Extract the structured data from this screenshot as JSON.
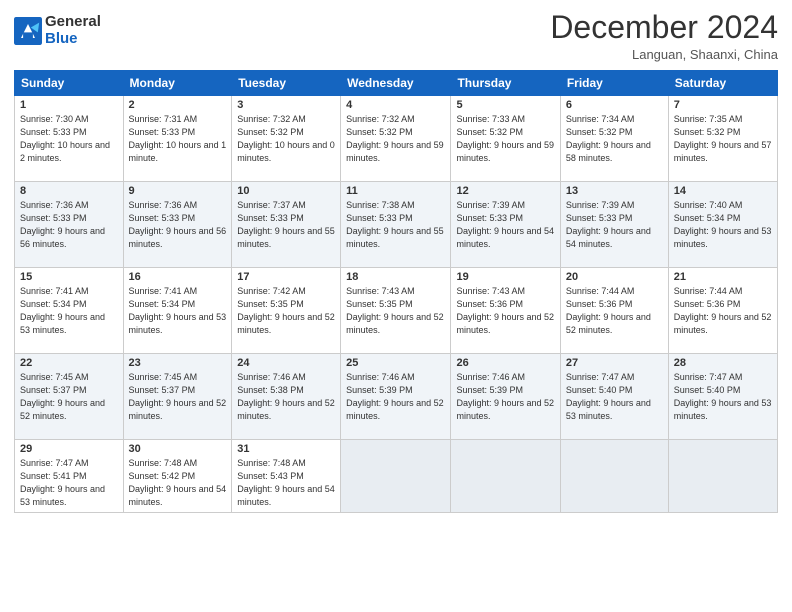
{
  "logo": {
    "line1": "General",
    "line2": "Blue"
  },
  "title": "December 2024",
  "location": "Languan, Shaanxi, China",
  "days_of_week": [
    "Sunday",
    "Monday",
    "Tuesday",
    "Wednesday",
    "Thursday",
    "Friday",
    "Saturday"
  ],
  "weeks": [
    [
      {
        "day": "1",
        "sunrise": "7:30 AM",
        "sunset": "5:33 PM",
        "daylight": "10 hours and 2 minutes."
      },
      {
        "day": "2",
        "sunrise": "7:31 AM",
        "sunset": "5:33 PM",
        "daylight": "10 hours and 1 minute."
      },
      {
        "day": "3",
        "sunrise": "7:32 AM",
        "sunset": "5:32 PM",
        "daylight": "10 hours and 0 minutes."
      },
      {
        "day": "4",
        "sunrise": "7:32 AM",
        "sunset": "5:32 PM",
        "daylight": "9 hours and 59 minutes."
      },
      {
        "day": "5",
        "sunrise": "7:33 AM",
        "sunset": "5:32 PM",
        "daylight": "9 hours and 59 minutes."
      },
      {
        "day": "6",
        "sunrise": "7:34 AM",
        "sunset": "5:32 PM",
        "daylight": "9 hours and 58 minutes."
      },
      {
        "day": "7",
        "sunrise": "7:35 AM",
        "sunset": "5:32 PM",
        "daylight": "9 hours and 57 minutes."
      }
    ],
    [
      {
        "day": "8",
        "sunrise": "7:36 AM",
        "sunset": "5:33 PM",
        "daylight": "9 hours and 56 minutes."
      },
      {
        "day": "9",
        "sunrise": "7:36 AM",
        "sunset": "5:33 PM",
        "daylight": "9 hours and 56 minutes."
      },
      {
        "day": "10",
        "sunrise": "7:37 AM",
        "sunset": "5:33 PM",
        "daylight": "9 hours and 55 minutes."
      },
      {
        "day": "11",
        "sunrise": "7:38 AM",
        "sunset": "5:33 PM",
        "daylight": "9 hours and 55 minutes."
      },
      {
        "day": "12",
        "sunrise": "7:39 AM",
        "sunset": "5:33 PM",
        "daylight": "9 hours and 54 minutes."
      },
      {
        "day": "13",
        "sunrise": "7:39 AM",
        "sunset": "5:33 PM",
        "daylight": "9 hours and 54 minutes."
      },
      {
        "day": "14",
        "sunrise": "7:40 AM",
        "sunset": "5:34 PM",
        "daylight": "9 hours and 53 minutes."
      }
    ],
    [
      {
        "day": "15",
        "sunrise": "7:41 AM",
        "sunset": "5:34 PM",
        "daylight": "9 hours and 53 minutes."
      },
      {
        "day": "16",
        "sunrise": "7:41 AM",
        "sunset": "5:34 PM",
        "daylight": "9 hours and 53 minutes."
      },
      {
        "day": "17",
        "sunrise": "7:42 AM",
        "sunset": "5:35 PM",
        "daylight": "9 hours and 52 minutes."
      },
      {
        "day": "18",
        "sunrise": "7:43 AM",
        "sunset": "5:35 PM",
        "daylight": "9 hours and 52 minutes."
      },
      {
        "day": "19",
        "sunrise": "7:43 AM",
        "sunset": "5:36 PM",
        "daylight": "9 hours and 52 minutes."
      },
      {
        "day": "20",
        "sunrise": "7:44 AM",
        "sunset": "5:36 PM",
        "daylight": "9 hours and 52 minutes."
      },
      {
        "day": "21",
        "sunrise": "7:44 AM",
        "sunset": "5:36 PM",
        "daylight": "9 hours and 52 minutes."
      }
    ],
    [
      {
        "day": "22",
        "sunrise": "7:45 AM",
        "sunset": "5:37 PM",
        "daylight": "9 hours and 52 minutes."
      },
      {
        "day": "23",
        "sunrise": "7:45 AM",
        "sunset": "5:37 PM",
        "daylight": "9 hours and 52 minutes."
      },
      {
        "day": "24",
        "sunrise": "7:46 AM",
        "sunset": "5:38 PM",
        "daylight": "9 hours and 52 minutes."
      },
      {
        "day": "25",
        "sunrise": "7:46 AM",
        "sunset": "5:39 PM",
        "daylight": "9 hours and 52 minutes."
      },
      {
        "day": "26",
        "sunrise": "7:46 AM",
        "sunset": "5:39 PM",
        "daylight": "9 hours and 52 minutes."
      },
      {
        "day": "27",
        "sunrise": "7:47 AM",
        "sunset": "5:40 PM",
        "daylight": "9 hours and 53 minutes."
      },
      {
        "day": "28",
        "sunrise": "7:47 AM",
        "sunset": "5:40 PM",
        "daylight": "9 hours and 53 minutes."
      }
    ],
    [
      {
        "day": "29",
        "sunrise": "7:47 AM",
        "sunset": "5:41 PM",
        "daylight": "9 hours and 53 minutes."
      },
      {
        "day": "30",
        "sunrise": "7:48 AM",
        "sunset": "5:42 PM",
        "daylight": "9 hours and 54 minutes."
      },
      {
        "day": "31",
        "sunrise": "7:48 AM",
        "sunset": "5:43 PM",
        "daylight": "9 hours and 54 minutes."
      },
      null,
      null,
      null,
      null
    ]
  ]
}
